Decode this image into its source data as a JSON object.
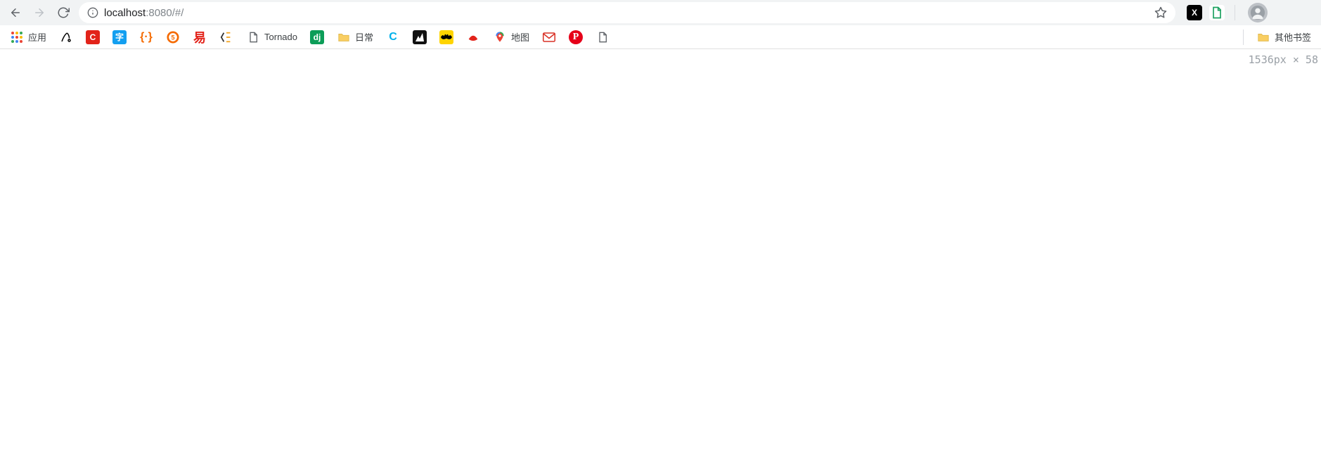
{
  "address_bar": {
    "host": "localhost",
    "rest": ":8080/#/"
  },
  "extensions": {
    "x_label": "X"
  },
  "bookmarks": {
    "apps_label": "应用",
    "tornado_label": "Tornado",
    "dj_label": "dj",
    "daily_label": "日常",
    "maps_label": "地图",
    "other_label": "其他书签"
  },
  "readout": {
    "text": "1536px × 58"
  }
}
